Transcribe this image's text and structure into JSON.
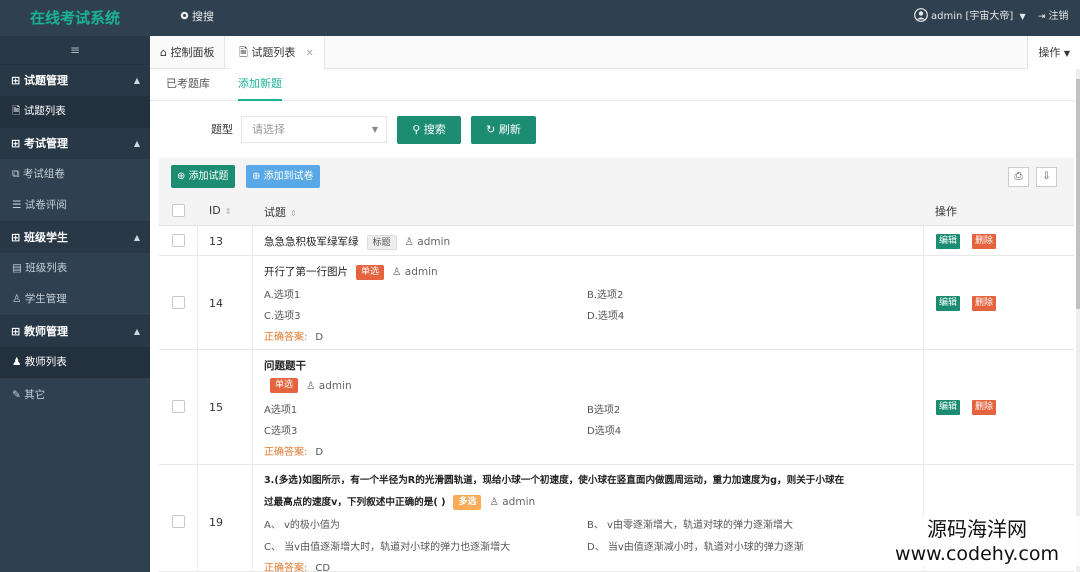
{
  "app": {
    "brand": "在线考试系统"
  },
  "topbar": {
    "search_label": "搜搜",
    "user_label": "admin [宇宙大帝]",
    "logout_label": "注销"
  },
  "sidebar": {
    "toggle": "≡",
    "groups": [
      {
        "label": "试题管理",
        "items": [
          {
            "label": "试题列表"
          }
        ]
      },
      {
        "label": "考试管理",
        "items": [
          {
            "label": "考试组卷"
          },
          {
            "label": "试卷评阅"
          }
        ]
      },
      {
        "label": "班级学生",
        "items": [
          {
            "label": "班级列表"
          },
          {
            "label": "学生管理"
          }
        ]
      },
      {
        "label": "教师管理",
        "items": [
          {
            "label": "教师列表"
          }
        ]
      }
    ],
    "other": "其它"
  },
  "tabs": [
    {
      "label": "控制面板"
    },
    {
      "label": "试题列表"
    }
  ],
  "ops_label": "操作",
  "subtabs": [
    {
      "label": "已考题库"
    },
    {
      "label": "添加新题"
    }
  ],
  "filter": {
    "label": "题型",
    "placeholder": "请选择",
    "search_btn": "搜索",
    "refresh_btn": "刷新"
  },
  "toolbar": {
    "add_question": "添加试题",
    "add_exam": "添加到试卷"
  },
  "table": {
    "headers": {
      "id": "ID",
      "title": "试题",
      "ops": "操作"
    },
    "rows": [
      {
        "id": "13",
        "title": "急急急积极军绿军绿",
        "tag": "标题",
        "author": "admin"
      },
      {
        "id": "14",
        "title": "开行了第一行图片",
        "tag": "单选",
        "author": "admin",
        "options": [
          "A.选项1",
          "B.选项2",
          "C.选项3",
          "D.选项4"
        ],
        "answer_label": "正确答案:",
        "answer": "D"
      },
      {
        "id": "15",
        "title": "问题题干",
        "tag": "单选",
        "author": "admin",
        "options": [
          "A选项1",
          "B选项2",
          "C选项3",
          "D选项4"
        ],
        "answer_label": "正确答案:",
        "answer": "D"
      },
      {
        "id": "19",
        "title_line1": "3.(多选)如图所示，有一个半径为R的光滑圆轨道，现给小球一个初速度，使小球在竖直面内做圆周运动，重力加速度为g，则关于小球在",
        "title_line2": "过最高点的速度v，下列叙述中正确的是(      )",
        "tag": "多选",
        "author": "admin",
        "options": [
          "A、 v的极小值为",
          "B、 v由零逐渐增大，轨道对球的弹力逐渐增大",
          "C、 当v由值逐渐增大时，轨道对小球的弹力也逐渐增大",
          "D、 当v由值逐渐减小时，轨道对小球的弹力逐渐"
        ],
        "answer_label": "正确答案:",
        "answer": "CD"
      }
    ],
    "edit_label": "编辑",
    "delete_label": "删除"
  },
  "watermark": {
    "line1": "源码海洋网",
    "line2": "www.codehy.com"
  },
  "colors": {
    "sidebar": "#2f4050",
    "accent": "#1ab394",
    "button": "#1c8d73",
    "danger": "#e5633f",
    "primary_blue": "#5aa9e6"
  }
}
